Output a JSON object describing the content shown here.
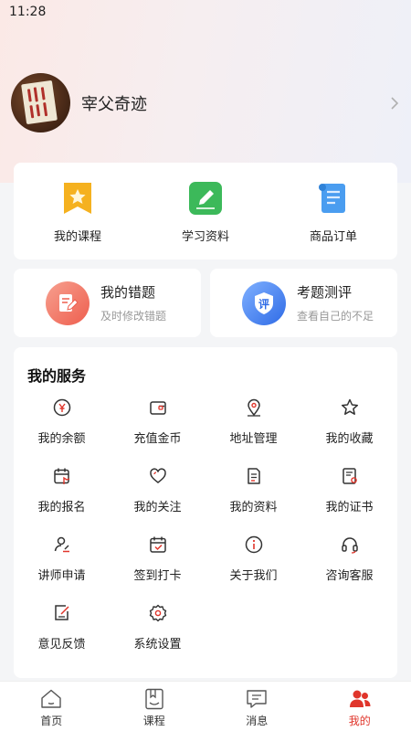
{
  "status_bar": {
    "time": "11:28"
  },
  "profile": {
    "nickname": "宰父奇迹"
  },
  "main_entries": [
    {
      "label": "我的课程",
      "icon": "bookmark-star-icon",
      "color": "#f5b11f"
    },
    {
      "label": "学习资料",
      "icon": "pencil-note-icon",
      "color": "#3cb95a"
    },
    {
      "label": "商品订单",
      "icon": "scroll-list-icon",
      "color": "#4a9df0"
    }
  ],
  "wrong_questions": {
    "title": "我的错题",
    "subtitle": "及时修改错题",
    "icon": "edit-note-icon",
    "color": "#f0675a"
  },
  "exam_eval": {
    "title": "考题测评",
    "subtitle": "查看自己的不足",
    "icon": "shield-eval-icon",
    "badge": "评",
    "color": "#3d7bef"
  },
  "services": {
    "title": "我的服务",
    "items": [
      {
        "label": "我的余额",
        "icon": "yen-coin-icon"
      },
      {
        "label": "充值金币",
        "icon": "wallet-icon"
      },
      {
        "label": "地址管理",
        "icon": "location-pin-icon"
      },
      {
        "label": "我的收藏",
        "icon": "star-icon"
      },
      {
        "label": "我的报名",
        "icon": "calendar-touch-icon"
      },
      {
        "label": "我的关注",
        "icon": "heart-icon"
      },
      {
        "label": "我的资料",
        "icon": "document-icon"
      },
      {
        "label": "我的证书",
        "icon": "certificate-icon"
      },
      {
        "label": "讲师申请",
        "icon": "user-edit-icon"
      },
      {
        "label": "签到打卡",
        "icon": "calendar-check-icon"
      },
      {
        "label": "关于我们",
        "icon": "info-icon"
      },
      {
        "label": "咨询客服",
        "icon": "headset-icon"
      },
      {
        "label": "意见反馈",
        "icon": "feedback-icon"
      },
      {
        "label": "系统设置",
        "icon": "gear-icon"
      }
    ]
  },
  "tabbar": [
    {
      "label": "首页",
      "icon": "home-icon",
      "active": false
    },
    {
      "label": "课程",
      "icon": "course-icon",
      "active": false
    },
    {
      "label": "消息",
      "icon": "message-icon",
      "active": false
    },
    {
      "label": "我的",
      "icon": "profile-icon",
      "active": true
    }
  ],
  "colors": {
    "accent": "#e0352b",
    "icon_line": "#333333"
  }
}
